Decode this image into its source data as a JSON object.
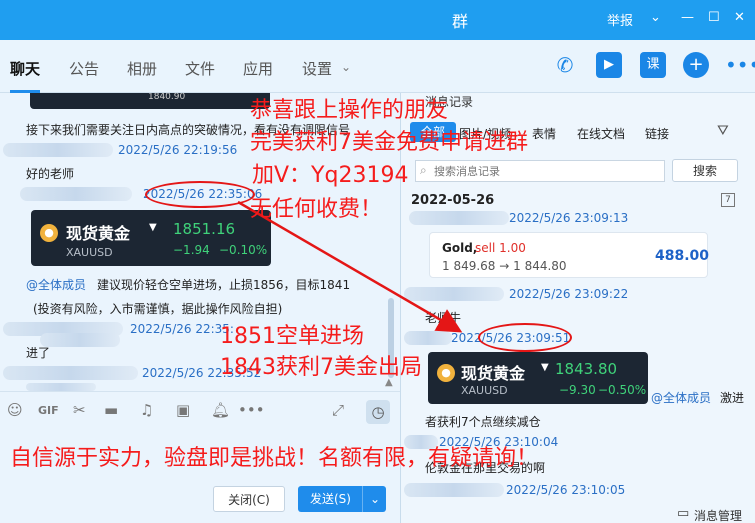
{
  "window": {
    "title_fragment": "群",
    "report": "举报"
  },
  "tabs": [
    "聊天",
    "公告",
    "相册",
    "文件",
    "应用",
    "设置"
  ],
  "left_chat": {
    "top_card_value": "1840.90",
    "line1": "接下来我们需要关注日内高点的突破情况，看有没有调限信号",
    "ts1": "2022/5/26 22:19:56",
    "line2": "好的老师",
    "ts2": "2022/5/26 22:35:06",
    "gold_card": {
      "name": "现货黄金",
      "code": "XAUUSD",
      "price": "1851.16",
      "change": "−1.94",
      "pct": "−0.10%"
    },
    "at_all": "@全体成员",
    "line3": "建议现价轻仓空单进场，止损1856，目标1841",
    "line4": "(投资有风险，入市需谨慎，据此操作风险自担)",
    "ts3": "2022/5/26 22:35:",
    "line5": "进了",
    "ts4": "2022/5/26 22:35:52",
    "close_btn": "关闭(C)",
    "send_btn": "发送(S)"
  },
  "right_panel": {
    "title": "消息记录",
    "filters": [
      "全部",
      "图片/视频",
      "表情",
      "在线文档",
      "链接"
    ],
    "search_placeholder": "搜索消息记录",
    "search_btn": "搜索",
    "date": "2022-05-26",
    "ts1": "2022/5/26 23:09:13",
    "quote": {
      "title": "Gold,",
      "sell": "sell 1.00",
      "range": "1 849.68 → 1 844.80",
      "profit": "488.00"
    },
    "ts2": "2022/5/26 23:09:22",
    "msg1": "老师牛",
    "ts3": "2022/5/26 23:09:51",
    "gold_card": {
      "name": "现货黄金",
      "code": "XAUUSD",
      "price": "1843.80",
      "change": "−9.30",
      "pct": "−0.50%"
    },
    "at_all": "@全体成员",
    "at_text": "激进",
    "msg2": "者获利7个点继续减仓",
    "ts4": "2022/5/26 23:10:04",
    "msg3": "伦敦金在那里交易的啊",
    "ts5": "2022/5/26 23:10:05",
    "manage": "消息管理"
  },
  "overlay": {
    "t1": "恭喜跟上操作的朋友",
    "t2": "完美获利7美金免费申请进群",
    "t3": "加V：Yq23194",
    "t4": "无任何收费！",
    "t5": "1851空单进场",
    "t6": "1843获利7美金出局",
    "t7": "自信源于实力，验盘即是挑战！名额有限，有疑请询！"
  }
}
